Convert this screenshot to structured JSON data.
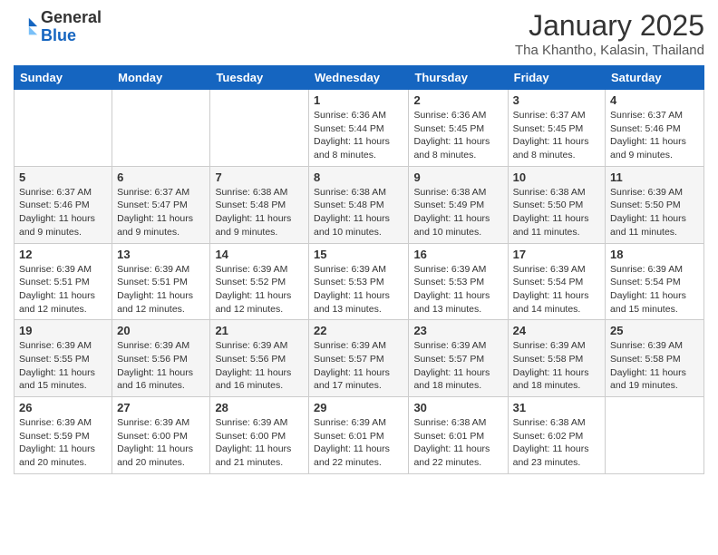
{
  "header": {
    "logo_general": "General",
    "logo_blue": "Blue",
    "month": "January 2025",
    "location": "Tha Khantho, Kalasin, Thailand"
  },
  "days_of_week": [
    "Sunday",
    "Monday",
    "Tuesday",
    "Wednesday",
    "Thursday",
    "Friday",
    "Saturday"
  ],
  "weeks": [
    [
      {
        "day": "",
        "info": ""
      },
      {
        "day": "",
        "info": ""
      },
      {
        "day": "",
        "info": ""
      },
      {
        "day": "1",
        "info": "Sunrise: 6:36 AM\nSunset: 5:44 PM\nDaylight: 11 hours and 8 minutes."
      },
      {
        "day": "2",
        "info": "Sunrise: 6:36 AM\nSunset: 5:45 PM\nDaylight: 11 hours and 8 minutes."
      },
      {
        "day": "3",
        "info": "Sunrise: 6:37 AM\nSunset: 5:45 PM\nDaylight: 11 hours and 8 minutes."
      },
      {
        "day": "4",
        "info": "Sunrise: 6:37 AM\nSunset: 5:46 PM\nDaylight: 11 hours and 9 minutes."
      }
    ],
    [
      {
        "day": "5",
        "info": "Sunrise: 6:37 AM\nSunset: 5:46 PM\nDaylight: 11 hours and 9 minutes."
      },
      {
        "day": "6",
        "info": "Sunrise: 6:37 AM\nSunset: 5:47 PM\nDaylight: 11 hours and 9 minutes."
      },
      {
        "day": "7",
        "info": "Sunrise: 6:38 AM\nSunset: 5:48 PM\nDaylight: 11 hours and 9 minutes."
      },
      {
        "day": "8",
        "info": "Sunrise: 6:38 AM\nSunset: 5:48 PM\nDaylight: 11 hours and 10 minutes."
      },
      {
        "day": "9",
        "info": "Sunrise: 6:38 AM\nSunset: 5:49 PM\nDaylight: 11 hours and 10 minutes."
      },
      {
        "day": "10",
        "info": "Sunrise: 6:38 AM\nSunset: 5:50 PM\nDaylight: 11 hours and 11 minutes."
      },
      {
        "day": "11",
        "info": "Sunrise: 6:39 AM\nSunset: 5:50 PM\nDaylight: 11 hours and 11 minutes."
      }
    ],
    [
      {
        "day": "12",
        "info": "Sunrise: 6:39 AM\nSunset: 5:51 PM\nDaylight: 11 hours and 12 minutes."
      },
      {
        "day": "13",
        "info": "Sunrise: 6:39 AM\nSunset: 5:51 PM\nDaylight: 11 hours and 12 minutes."
      },
      {
        "day": "14",
        "info": "Sunrise: 6:39 AM\nSunset: 5:52 PM\nDaylight: 11 hours and 12 minutes."
      },
      {
        "day": "15",
        "info": "Sunrise: 6:39 AM\nSunset: 5:53 PM\nDaylight: 11 hours and 13 minutes."
      },
      {
        "day": "16",
        "info": "Sunrise: 6:39 AM\nSunset: 5:53 PM\nDaylight: 11 hours and 13 minutes."
      },
      {
        "day": "17",
        "info": "Sunrise: 6:39 AM\nSunset: 5:54 PM\nDaylight: 11 hours and 14 minutes."
      },
      {
        "day": "18",
        "info": "Sunrise: 6:39 AM\nSunset: 5:54 PM\nDaylight: 11 hours and 15 minutes."
      }
    ],
    [
      {
        "day": "19",
        "info": "Sunrise: 6:39 AM\nSunset: 5:55 PM\nDaylight: 11 hours and 15 minutes."
      },
      {
        "day": "20",
        "info": "Sunrise: 6:39 AM\nSunset: 5:56 PM\nDaylight: 11 hours and 16 minutes."
      },
      {
        "day": "21",
        "info": "Sunrise: 6:39 AM\nSunset: 5:56 PM\nDaylight: 11 hours and 16 minutes."
      },
      {
        "day": "22",
        "info": "Sunrise: 6:39 AM\nSunset: 5:57 PM\nDaylight: 11 hours and 17 minutes."
      },
      {
        "day": "23",
        "info": "Sunrise: 6:39 AM\nSunset: 5:57 PM\nDaylight: 11 hours and 18 minutes."
      },
      {
        "day": "24",
        "info": "Sunrise: 6:39 AM\nSunset: 5:58 PM\nDaylight: 11 hours and 18 minutes."
      },
      {
        "day": "25",
        "info": "Sunrise: 6:39 AM\nSunset: 5:58 PM\nDaylight: 11 hours and 19 minutes."
      }
    ],
    [
      {
        "day": "26",
        "info": "Sunrise: 6:39 AM\nSunset: 5:59 PM\nDaylight: 11 hours and 20 minutes."
      },
      {
        "day": "27",
        "info": "Sunrise: 6:39 AM\nSunset: 6:00 PM\nDaylight: 11 hours and 20 minutes."
      },
      {
        "day": "28",
        "info": "Sunrise: 6:39 AM\nSunset: 6:00 PM\nDaylight: 11 hours and 21 minutes."
      },
      {
        "day": "29",
        "info": "Sunrise: 6:39 AM\nSunset: 6:01 PM\nDaylight: 11 hours and 22 minutes."
      },
      {
        "day": "30",
        "info": "Sunrise: 6:38 AM\nSunset: 6:01 PM\nDaylight: 11 hours and 22 minutes."
      },
      {
        "day": "31",
        "info": "Sunrise: 6:38 AM\nSunset: 6:02 PM\nDaylight: 11 hours and 23 minutes."
      },
      {
        "day": "",
        "info": ""
      }
    ]
  ]
}
